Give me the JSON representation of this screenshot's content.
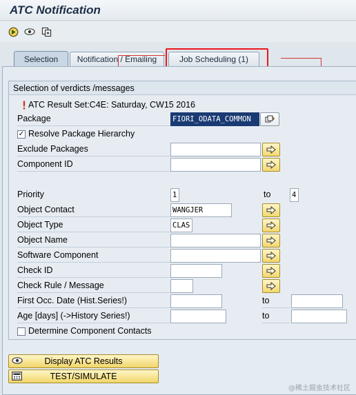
{
  "window": {
    "title": "ATC Notification"
  },
  "toolbar": {
    "icons": [
      "execute-icon",
      "display-icon",
      "copy-icon"
    ]
  },
  "tabs": [
    {
      "label": "Selection",
      "active": true
    },
    {
      "label": "Notification / Emailing",
      "active": false
    },
    {
      "label": "Job Scheduling (1)",
      "active": false
    }
  ],
  "group": {
    "title": "Selection of verdicts /messages",
    "result_set": "ATC Result Set:C4E: Saturday, CW15 2016",
    "package": {
      "label": "Package",
      "value": "FIORI_ODATA_COMMON"
    },
    "resolve_hierarchy": {
      "label": "Resolve Package Hierarchy",
      "checked": true
    },
    "exclude_packages": {
      "label": "Exclude Packages",
      "value": ""
    },
    "component_id": {
      "label": "Component ID",
      "value": ""
    },
    "priority": {
      "label": "Priority",
      "from": "1",
      "to_label": "to",
      "to": "4"
    },
    "object_contact": {
      "label": "Object Contact",
      "value": "WANGJER"
    },
    "object_type": {
      "label": "Object Type",
      "value": "CLAS"
    },
    "object_name": {
      "label": "Object Name",
      "value": ""
    },
    "software_component": {
      "label": "Software Component",
      "value": ""
    },
    "check_id": {
      "label": "Check ID",
      "value": ""
    },
    "check_rule": {
      "label": "Check Rule / Message",
      "value": ""
    },
    "first_occ": {
      "label": "First Occ. Date (Hist.Series!)",
      "from": "",
      "to_label": "to",
      "to": ""
    },
    "age_days": {
      "label": "Age [days] (->History Series!)",
      "from": "",
      "to_label": "to",
      "to": ""
    },
    "determine_contacts": {
      "label": "Determine Component Contacts",
      "checked": false
    }
  },
  "buttons": {
    "display_results": "Display ATC Results",
    "test_simulate": "TEST/SIMULATE"
  },
  "watermark": "@稀土掘金技术社区",
  "colors": {
    "highlight": "#e8161a",
    "accent_yellow": "#f3d870",
    "selected_field": "#1a3a73"
  }
}
